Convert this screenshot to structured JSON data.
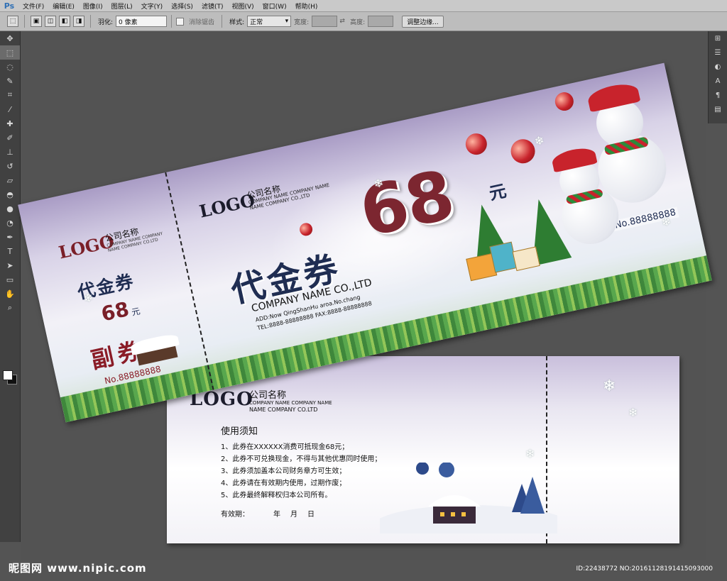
{
  "app": {
    "logo": "Ps"
  },
  "menu": [
    "文件(F)",
    "编辑(E)",
    "图像(I)",
    "图层(L)",
    "文字(Y)",
    "选择(S)",
    "滤镜(T)",
    "视图(V)",
    "窗口(W)",
    "帮助(H)"
  ],
  "options": {
    "feather_label": "羽化:",
    "feather_value": "0 像素",
    "antialias_label": "消除锯齿",
    "style_label": "样式:",
    "style_value": "正常",
    "width_label": "宽度:",
    "height_label": "高度:",
    "refine_edge_label": "调整边缘..."
  },
  "front_coupon": {
    "stub": {
      "logo": "LOGO",
      "company_cn": "公司名称",
      "company_en_1": "COMPANY NAME COMPANY",
      "company_en_2": "NAME COMPANY CO.LTD",
      "title": "代金券",
      "amount": "68",
      "unit": "元",
      "copy_label": "副券",
      "serial": "No.88888888"
    },
    "main": {
      "logo": "LOGO",
      "company_cn": "公司名称",
      "company_en_1": "COMPANY NAME COMPANY NAME",
      "company_en_2": "NAME COMPANY CO.,LTD",
      "amount": "68",
      "unit": "元",
      "title": "代金券",
      "company_en": "COMPANY NAME CO.,LTD",
      "address": "ADD:Now QingShanHu aroa.No.chang",
      "tel": "TEL:8888-88888888   FAX:8888-88888888",
      "serial": "No.88888888"
    }
  },
  "back_coupon": {
    "logo": "LOGO",
    "company_cn": "公司名称",
    "company_en_1": "COMPANY NAME COMPANY NAME",
    "company_en_2": "NAME COMPANY CO.LTD",
    "notice_title": "使用须知",
    "rules": [
      "1、此券在XXXXXX消费可抵现金68元；",
      "2、此券不可兑换现金，不得与其他优惠同时使用；",
      "3、此券须加盖本公司财务章方可生效；",
      "4、此券请在有效期内使用，过期作废；",
      "5、此券最终解释权归本公司所有。"
    ],
    "validity_label": "有效期：",
    "validity_year": "年",
    "validity_month": "月",
    "validity_day": "日"
  },
  "footer": {
    "watermark": "昵图网 www.nipic.com",
    "id_text": "ID:22438772 NO:20161128191415093000"
  },
  "colors": {
    "coupon_red": "#7c2630",
    "coupon_navy": "#1f2d52",
    "ps_canvas": "#535353"
  }
}
